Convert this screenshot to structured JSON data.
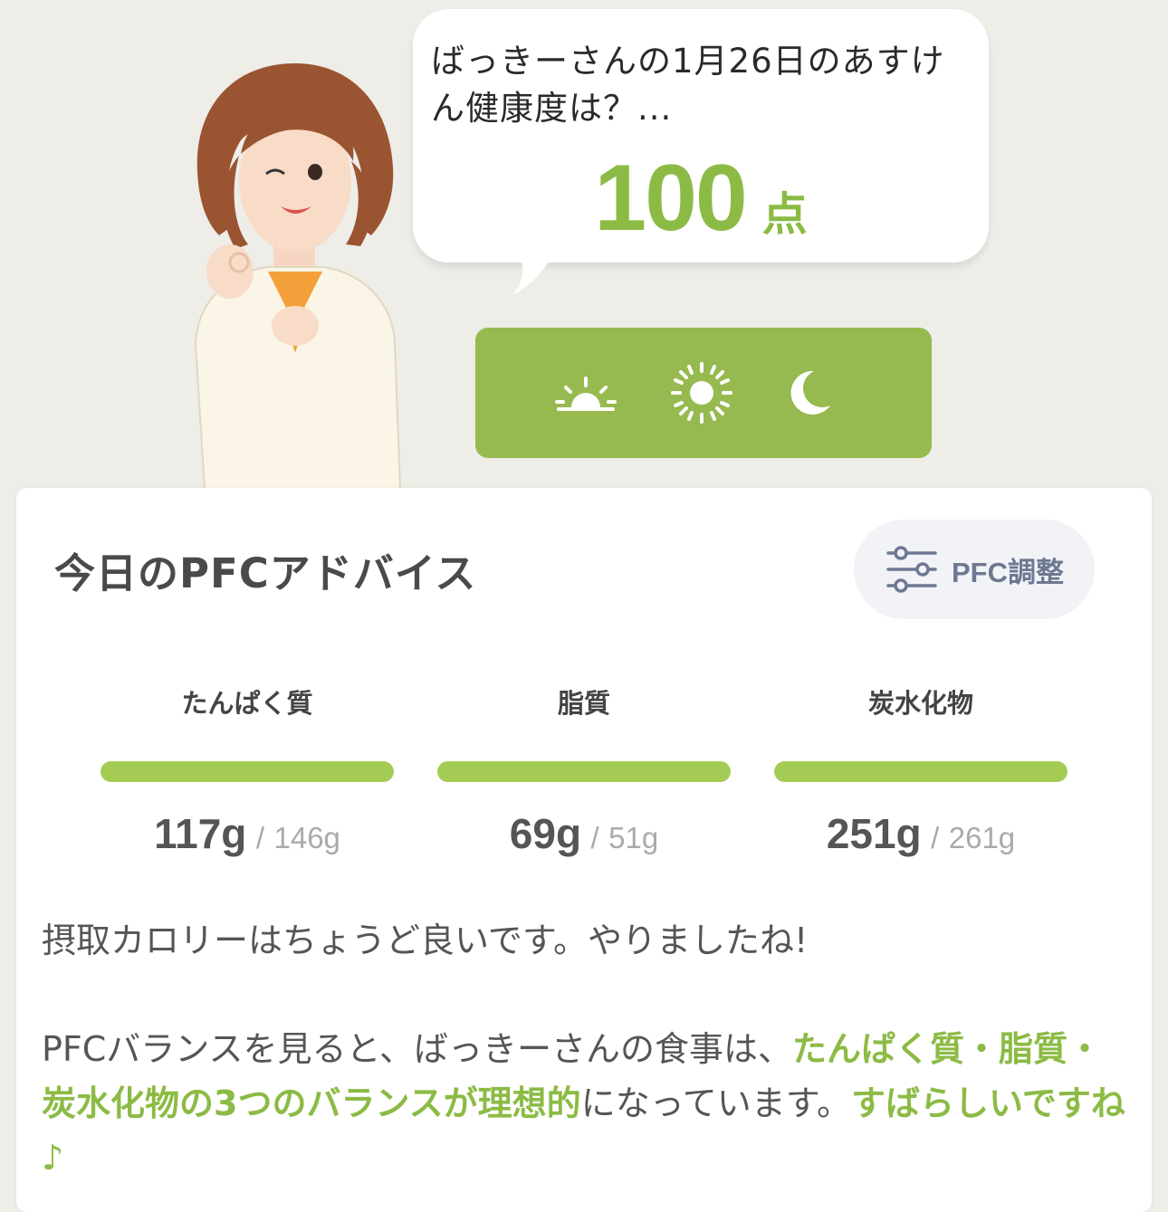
{
  "bubble": {
    "message": "ばっきーさんの1月26日のあすけん健康度は？...",
    "score": "100",
    "score_unit": "点"
  },
  "time_of_day": {
    "icons": [
      "sunrise-icon",
      "sun-icon",
      "moon-icon"
    ]
  },
  "pfc_card": {
    "title": "今日のPFCアドバイス",
    "adjust_button": {
      "label": "PFC調整",
      "icon": "sliders-icon"
    },
    "macros": [
      {
        "name": "たんぱく質",
        "actual": "117g",
        "separator": "/",
        "target": "146g",
        "bar_fill": 1.0
      },
      {
        "name": "脂質",
        "actual": "69g",
        "separator": "/",
        "target": "51g",
        "bar_fill": 1.0
      },
      {
        "name": "炭水化物",
        "actual": "251g",
        "separator": "/",
        "target": "261g",
        "bar_fill": 1.0
      }
    ],
    "advice": {
      "line1": "摂取カロリーはちょうど良いです。やりましたね!",
      "p2_a": "PFCバランスを見ると、ばっきーさんの食事は、",
      "p2_b": "たんぱく質・脂質・炭水化物の3つのバランスが理想的",
      "p2_c": "になっています。",
      "p2_d": "すばらしいですね♪"
    }
  },
  "colors": {
    "accent_green": "#8cbb45",
    "bar_green": "#a4cc54",
    "selector_green": "#96ba4f",
    "background": "#eeede8"
  }
}
